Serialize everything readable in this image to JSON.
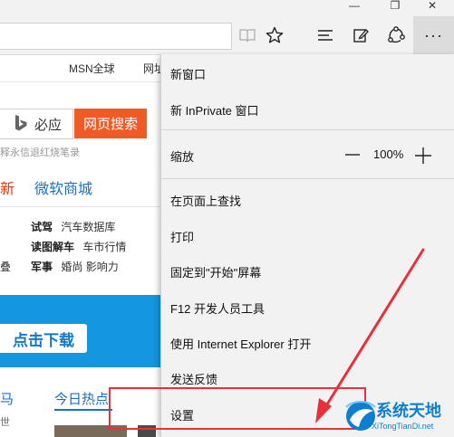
{
  "window": {
    "restore_glyph": "❐",
    "close_glyph": "✕"
  },
  "toolbar": {
    "icons": [
      "reading-view-icon",
      "favorite-star-icon",
      "hub-icon",
      "web-note-icon",
      "share-icon",
      "more-icon"
    ],
    "more_glyph": "···"
  },
  "page": {
    "top_links": [
      "MSN全球",
      "网址"
    ],
    "search": {
      "bing_label": "必应",
      "button_label": "网页搜索",
      "hint": "释永信退红烧笔录"
    },
    "nav": {
      "new_label": "新",
      "shop_label": "微软商城"
    },
    "categories": [
      {
        "bold": "试驾",
        "rest": "汽车数据库"
      },
      {
        "bold": "读图解车",
        "rest": "车市行情"
      },
      {
        "bold": "军事",
        "rest": "婚尚  影响力"
      }
    ],
    "left_fragment": "叠",
    "banner_button": "点击下载",
    "news_left": "马",
    "news_tab": "今日热点",
    "news_sub": "世"
  },
  "menu": {
    "items": [
      "新窗口",
      "新 InPrivate 窗口",
      "缩放",
      "在页面上查找",
      "打印",
      "固定到\"开始\"屏幕",
      "F12 开发人员工具",
      "使用 Internet Explorer 打开",
      "发送反馈",
      "设置"
    ],
    "zoom": {
      "value": "100%"
    }
  },
  "watermark": {
    "title": "系统天地",
    "url": "XiTongTianDi.net"
  },
  "colors": {
    "accent_orange": "#f05a24",
    "link_blue": "#1a6fc4",
    "annotation_red": "#e8303a",
    "watermark_blue": "#0e7fd0"
  }
}
